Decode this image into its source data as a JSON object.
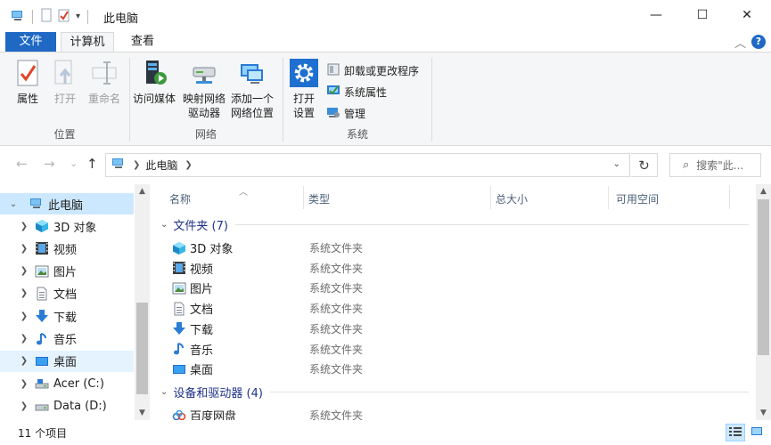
{
  "window": {
    "title": "此电脑",
    "minimize_glyph": "—",
    "maximize_glyph": "☐",
    "close_glyph": "✕"
  },
  "ribbon_tabs": {
    "file": "文件",
    "computer": "计算机",
    "view": "查看",
    "collapse_glyph": "︿",
    "help_glyph": "?"
  },
  "ribbon": {
    "location": {
      "label": "位置",
      "properties": "属性",
      "open": "打开",
      "rename": "重命名"
    },
    "network": {
      "label": "网络",
      "access_media": "访问媒体",
      "map_drive": "映射网络\n驱动器",
      "add_location": "添加一个\n网络位置"
    },
    "system": {
      "label": "系统",
      "open_settings": "打开\n设置",
      "uninstall": "卸载或更改程序",
      "system_properties": "系统属性",
      "manage": "管理"
    }
  },
  "address": {
    "back_glyph": "←",
    "forward_glyph": "→",
    "recent_glyph": "⌄",
    "up_glyph": "↑",
    "breadcrumb": "此电脑",
    "refresh_glyph": "↻",
    "search_placeholder": "搜索\"此..."
  },
  "nav_tree": {
    "root": "此电脑",
    "items": [
      "3D 对象",
      "视频",
      "图片",
      "文档",
      "下载",
      "音乐",
      "桌面",
      "Acer (C:)",
      "Data (D:)"
    ]
  },
  "columns": {
    "name": "名称",
    "type": "类型",
    "total_size": "总大小",
    "free_space": "可用空间"
  },
  "groups": {
    "folders": "文件夹 (7)",
    "devices": "设备和驱动器 (4)"
  },
  "folders": [
    {
      "name": "3D 对象",
      "type": "系统文件夹",
      "icon": "cube-icon"
    },
    {
      "name": "视频",
      "type": "系统文件夹",
      "icon": "film-icon"
    },
    {
      "name": "图片",
      "type": "系统文件夹",
      "icon": "picture-icon"
    },
    {
      "name": "文档",
      "type": "系统文件夹",
      "icon": "document-icon"
    },
    {
      "name": "下载",
      "type": "系统文件夹",
      "icon": "download-icon"
    },
    {
      "name": "音乐",
      "type": "系统文件夹",
      "icon": "music-icon"
    },
    {
      "name": "桌面",
      "type": "系统文件夹",
      "icon": "desktop-icon"
    }
  ],
  "devices": [
    {
      "name": "百度网盘",
      "type": "系统文件夹",
      "icon": "cloud-icon"
    }
  ],
  "status": {
    "item_count": "11 个项目"
  },
  "colors": {
    "accent": "#1f69c4",
    "selected": "#cce8ff",
    "group_text": "#1e3287"
  }
}
